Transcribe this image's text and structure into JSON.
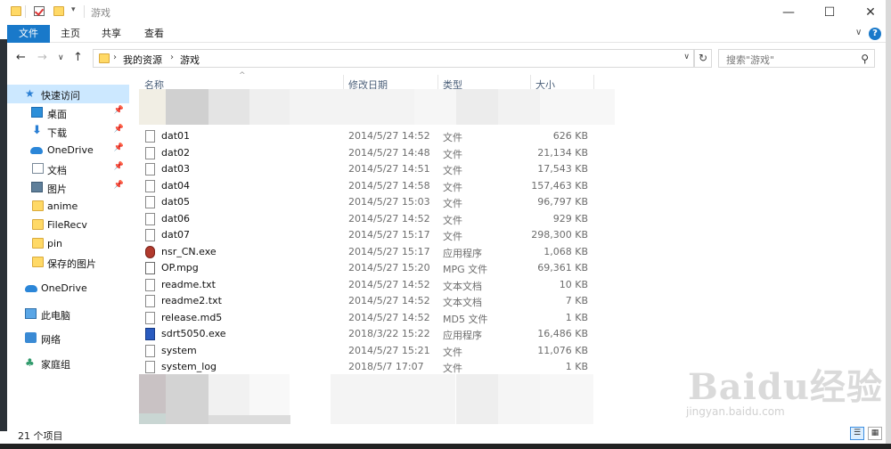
{
  "window": {
    "title": "游戏",
    "controls": [
      "—",
      "☐",
      "✕"
    ]
  },
  "ribbon": {
    "tabs": [
      "文件",
      "主页",
      "共享",
      "查看"
    ],
    "expand": "∨",
    "help": "?"
  },
  "address": {
    "crumbs": [
      "我的资源",
      "游戏"
    ],
    "separator": "›",
    "dropdown": "∨",
    "refresh": "↻",
    "search_placeholder": "搜索\"游戏\""
  },
  "nav": {
    "back": "←",
    "forward": "→",
    "recent": "∨",
    "up": "↑",
    "quick_access": "快速访问",
    "pinned": [
      {
        "label": "桌面",
        "icon": "desktop-icon"
      },
      {
        "label": "下载",
        "icon": "download-icon"
      },
      {
        "label": "OneDrive",
        "icon": "onedrive-icon"
      },
      {
        "label": "文档",
        "icon": "documents-icon"
      },
      {
        "label": "图片",
        "icon": "pictures-icon"
      }
    ],
    "folders": [
      "anime",
      "FileRecv",
      "pin",
      "保存的图片"
    ],
    "onedrive": "OneDrive",
    "this_pc": "此电脑",
    "network": "网络",
    "homegroup": "家庭组"
  },
  "columns": {
    "name": "名称",
    "date": "修改日期",
    "type": "类型",
    "size": "大小"
  },
  "files": [
    {
      "name": "dat01",
      "date": "2014/5/27 14:52",
      "type": "文件",
      "size": "626 KB",
      "icon": "file"
    },
    {
      "name": "dat02",
      "date": "2014/5/27 14:48",
      "type": "文件",
      "size": "21,134 KB",
      "icon": "file"
    },
    {
      "name": "dat03",
      "date": "2014/5/27 14:51",
      "type": "文件",
      "size": "17,543 KB",
      "icon": "file"
    },
    {
      "name": "dat04",
      "date": "2014/5/27 14:58",
      "type": "文件",
      "size": "157,463 KB",
      "icon": "file"
    },
    {
      "name": "dat05",
      "date": "2014/5/27 15:03",
      "type": "文件",
      "size": "96,797 KB",
      "icon": "file"
    },
    {
      "name": "dat06",
      "date": "2014/5/27 14:52",
      "type": "文件",
      "size": "929 KB",
      "icon": "file"
    },
    {
      "name": "dat07",
      "date": "2014/5/27 15:17",
      "type": "文件",
      "size": "298,300 KB",
      "icon": "file"
    },
    {
      "name": "nsr_CN.exe",
      "date": "2014/5/27 15:17",
      "type": "应用程序",
      "size": "1,068 KB",
      "icon": "exe"
    },
    {
      "name": "OP.mpg",
      "date": "2014/5/27 15:20",
      "type": "MPG 文件",
      "size": "69,361 KB",
      "icon": "mpg"
    },
    {
      "name": "readme.txt",
      "date": "2014/5/27 14:52",
      "type": "文本文档",
      "size": "10 KB",
      "icon": "file"
    },
    {
      "name": "readme2.txt",
      "date": "2014/5/27 14:52",
      "type": "文本文档",
      "size": "7 KB",
      "icon": "file"
    },
    {
      "name": "release.md5",
      "date": "2014/5/27 14:52",
      "type": "MD5 文件",
      "size": "1 KB",
      "icon": "file"
    },
    {
      "name": "sdrt5050.exe",
      "date": "2018/3/22 15:22",
      "type": "应用程序",
      "size": "16,486 KB",
      "icon": "app2"
    },
    {
      "name": "system",
      "date": "2014/5/27 15:21",
      "type": "文件",
      "size": "11,076 KB",
      "icon": "file"
    },
    {
      "name": "system_log",
      "date": "2018/5/7 17:07",
      "type": "文件",
      "size": "1 KB",
      "icon": "file"
    }
  ],
  "status": {
    "item_count": "21 个项目"
  },
  "watermark": {
    "logo": "Baidu经验",
    "url": "jingyan.baidu.com"
  },
  "colors": {
    "accent": "#1979ca",
    "selected": "#cce8ff",
    "folder": "#ffd966"
  }
}
